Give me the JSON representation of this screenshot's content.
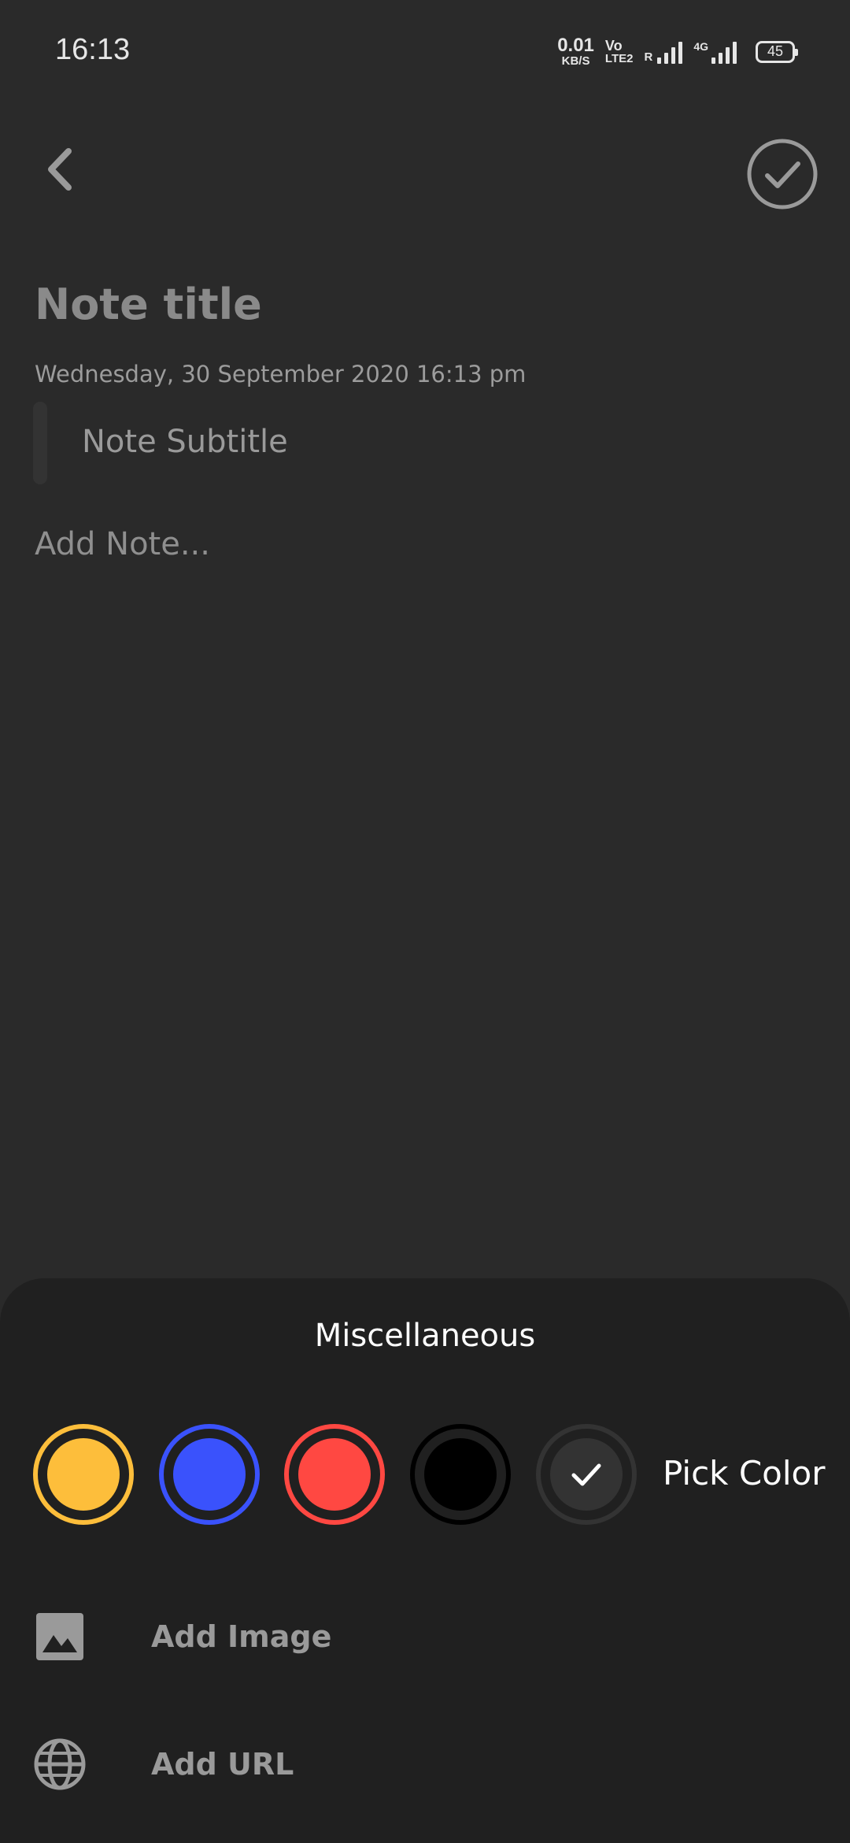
{
  "status_bar": {
    "time": "16:13",
    "net_speed_value": "0.01",
    "net_speed_unit": "KB/S",
    "volte_top": "Vo",
    "volte_bottom": "LTE2",
    "roaming": "R",
    "network_type": "4G",
    "battery": "45"
  },
  "note": {
    "title_placeholder": "Note title",
    "datetime": "Wednesday, 30 September 2020 16:13 pm",
    "subtitle_placeholder": "Note Subtitle",
    "body_placeholder": "Add Note..."
  },
  "sheet": {
    "title": "Miscellaneous",
    "colors": [
      {
        "name": "yellow",
        "hex": "#fdbe3b",
        "selected": false
      },
      {
        "name": "blue",
        "hex": "#3a52fc",
        "selected": false
      },
      {
        "name": "red",
        "hex": "#ff4842",
        "selected": false
      },
      {
        "name": "black",
        "hex": "#000000",
        "selected": false
      },
      {
        "name": "default",
        "hex": "#333333",
        "selected": true
      }
    ],
    "pick_color_label": "Pick Color",
    "add_image_label": "Add Image",
    "add_url_label": "Add URL"
  },
  "icons": {
    "back": "chevron-left-icon",
    "save": "check-circle-icon",
    "image": "image-icon",
    "url": "globe-icon",
    "selected": "check-icon"
  }
}
